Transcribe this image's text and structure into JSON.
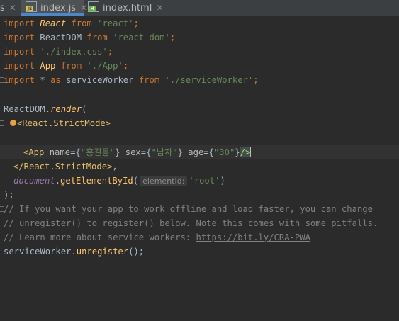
{
  "tabs": [
    {
      "label": "s",
      "icon": "",
      "active": false
    },
    {
      "label": "index.js",
      "icon": "js-file-icon",
      "icon_text": "JS",
      "active": true
    },
    {
      "label": "index.html",
      "icon": "html-file-icon",
      "icon_text": "H",
      "active": false
    }
  ],
  "code": {
    "l1": {
      "k": "import",
      "n": "React",
      "f": "from",
      "s": "'react'",
      "e": ";"
    },
    "l2": {
      "k": "import",
      "n": "ReactDOM",
      "f": "from",
      "s": "'react-dom'",
      "e": ";"
    },
    "l3": {
      "k": "import",
      "s": "'./index.css'",
      "e": ";"
    },
    "l4": {
      "k": "import",
      "n": "App",
      "f": "from",
      "s": "'./App'",
      "e": ";"
    },
    "l5": {
      "k": "import",
      "star": "*",
      "as": "as",
      "n": "serviceWorker",
      "f": "from",
      "s": "'./serviceWorker'",
      "e": ";"
    },
    "l7": {
      "obj": "ReactDOM",
      "dot": ".",
      "fn": "render",
      "p": "("
    },
    "l8": {
      "open": "<",
      "tag": "React.StrictMode",
      "close": ">"
    },
    "l9": {
      "open": "<",
      "tag": "App",
      "a1": "name",
      "v1": "\"홍길동\"",
      "a2": "sex",
      "v2": "\"남자\"",
      "a3": "age",
      "v3": "\"30\"",
      "end": "/>"
    },
    "l10": {
      "tag": "</React.StrictMode>",
      "c": ","
    },
    "l11": {
      "doc": "document",
      "dot": ".",
      "fn": "getElementById",
      "p": "(",
      "hint": "elementId:",
      "s": "'root'",
      "pc": ")"
    },
    "l12": ");",
    "l14": "// If you want your app to work offline and load faster, you can change",
    "l15": "// unregister() to register() below. Note this comes with some pitfalls.",
    "l16_pre": "// Learn more about service workers: ",
    "l16_link": "https://bit.ly/CRA-PWA",
    "l17": {
      "obj": "serviceWorker",
      "dot": ".",
      "fn": "unregister",
      "p": "();"
    }
  },
  "colors": {
    "background": "#2b2b2b",
    "keyword": "#cc7832",
    "string": "#6a8759",
    "comment": "#808080",
    "tag": "#e8bf6a",
    "function": "#ffc66d"
  }
}
